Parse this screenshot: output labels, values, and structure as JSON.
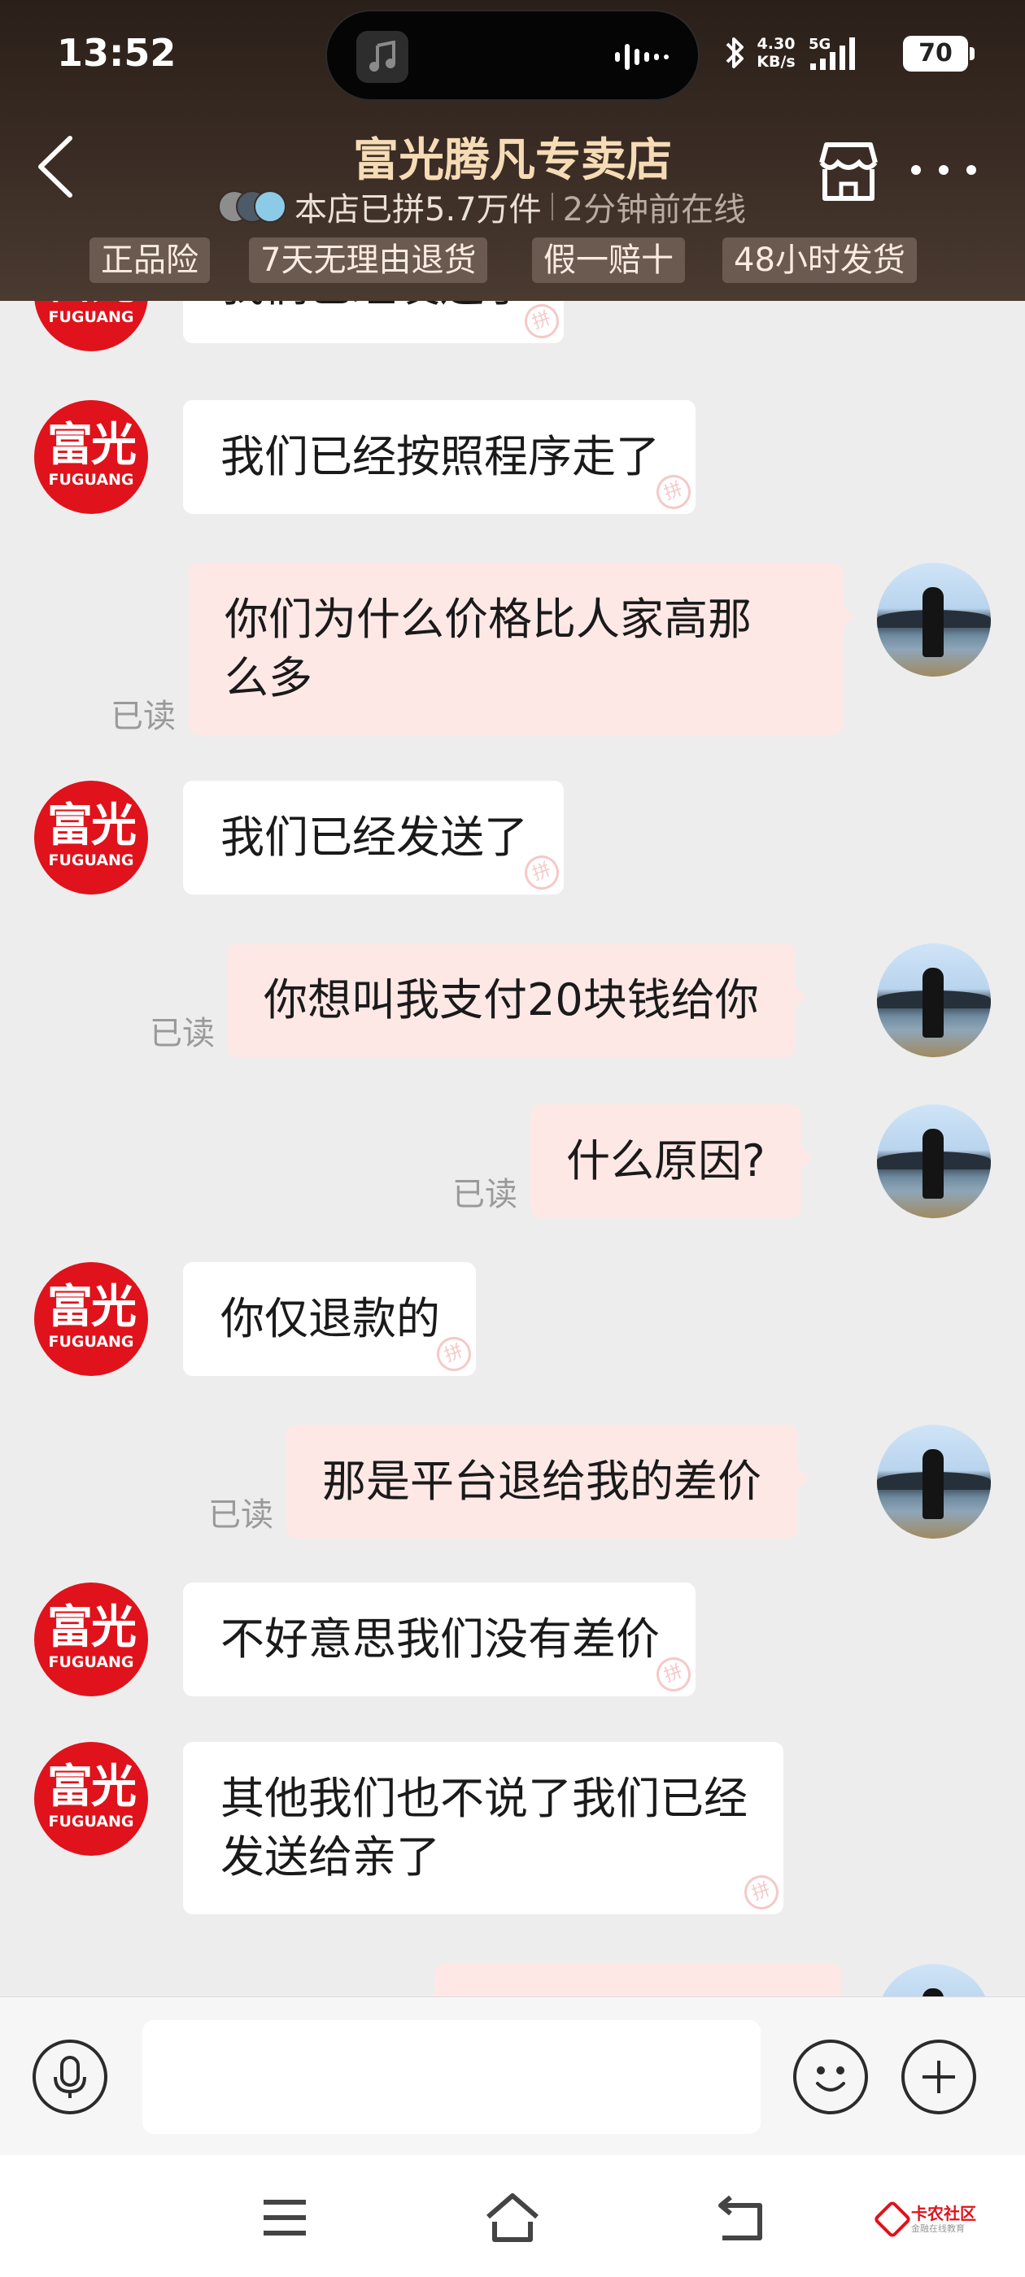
{
  "status_bar": {
    "time": "13:52",
    "net_speed_value": "4.30",
    "net_speed_unit": "KB/s",
    "network": "5G",
    "battery": "70"
  },
  "header": {
    "store_name": "富光腾凡专卖店",
    "sales_info": "本店已拼5.7万件",
    "online_status": "2分钟前在线",
    "tags": [
      "正品险",
      "7天无理由退货",
      "假一赔十",
      "48小时发货"
    ]
  },
  "brand": {
    "avatar_text": "富光",
    "avatar_subtext": "FUGUANG",
    "accent_color": "#e0121b",
    "watermark_char": "拼"
  },
  "messages": [
    {
      "side": "shop",
      "text": "我们已经发送了"
    },
    {
      "side": "shop",
      "text": "我们已经按照程序走了"
    },
    {
      "side": "user",
      "lines": [
        "你们为什么价格比人家高那",
        "么多"
      ],
      "status": "已读"
    },
    {
      "side": "shop",
      "text": "我们已经发送了"
    },
    {
      "side": "user",
      "text": "你想叫我支付20块钱给你",
      "status": "已读"
    },
    {
      "side": "user",
      "text": "什么原因?",
      "status": "已读"
    },
    {
      "side": "shop",
      "text": "你仅退款的"
    },
    {
      "side": "user",
      "text": "那是平台退给我的差价",
      "status": "已读"
    },
    {
      "side": "shop",
      "text": "不好意思我们没有差价"
    },
    {
      "side": "shop",
      "lines": [
        "其他我们也不说了我们已经",
        "发送给亲了"
      ]
    }
  ],
  "input": {
    "value": "",
    "voice_icon": "microphone-icon",
    "emoji_icon": "emoji-icon",
    "plus_icon": "plus-icon"
  },
  "footer": {
    "watermark_title": "卡农社区",
    "watermark_subtitle": "金融在线教育"
  },
  "colors": {
    "header_bg": "#3b2d25",
    "store_name": "#f6dcb6",
    "user_bubble": "#fde8e6",
    "shop_bubble": "#ffffff",
    "chat_bg": "#ededed"
  }
}
